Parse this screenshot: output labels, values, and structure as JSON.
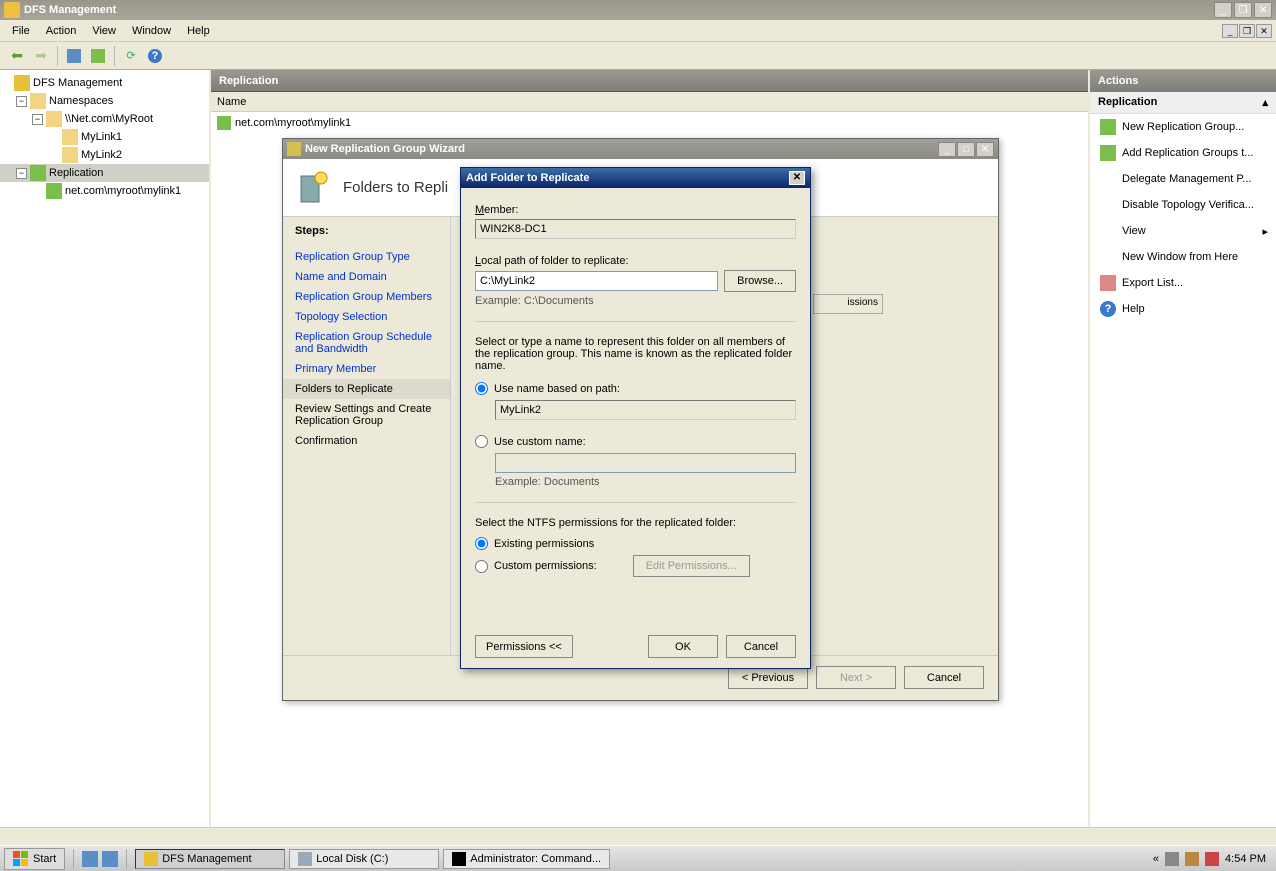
{
  "app": {
    "title": "DFS Management"
  },
  "menu": {
    "file": "File",
    "action": "Action",
    "view": "View",
    "window": "Window",
    "help": "Help"
  },
  "tree": {
    "root": "DFS Management",
    "namespaces": "Namespaces",
    "ns_root": "\\\\Net.com\\MyRoot",
    "link1": "MyLink1",
    "link2": "MyLink2",
    "replication": "Replication",
    "rep_item": "net.com\\myroot\\mylink1"
  },
  "center": {
    "group_header": "Replication",
    "col_name": "Name",
    "row1": "net.com\\myroot\\mylink1"
  },
  "actions": {
    "header": "Actions",
    "group": "Replication",
    "items": {
      "new_rep": "New Replication Group...",
      "add_rep": "Add Replication Groups t...",
      "delegate": "Delegate Management P...",
      "disable": "Disable Topology Verifica...",
      "view": "View",
      "newwin": "New Window from Here",
      "export": "Export List...",
      "help": "Help"
    }
  },
  "wizard": {
    "title": "New Replication Group Wizard",
    "heading": "Folders to Repli",
    "steps_header": "Steps:",
    "steps": {
      "s1": "Replication Group Type",
      "s2": "Name and Domain",
      "s3": "Replication Group Members",
      "s4": "Topology Selection",
      "s5": "Replication Group Schedule and Bandwidth",
      "s6": "Primary Member",
      "s7": "Folders to Replicate",
      "s8": "Review Settings and Create Replication Group",
      "s9": "Confirmation"
    },
    "hidden_tab": "issions",
    "buttons": {
      "prev": "< Previous",
      "next": "Next >",
      "cancel": "Cancel"
    }
  },
  "dialog": {
    "title": "Add Folder to Replicate",
    "member_label": "Member:",
    "member_value": "WIN2K8-DC1",
    "path_label": "Local path of folder to replicate:",
    "path_value": "C:\\MyLink2",
    "browse": "Browse...",
    "example_path": "Example: C:\\Documents",
    "name_instr": "Select or type a name to represent this folder on all members of the replication group. This name is known as the replicated folder name.",
    "radio_path": "Use name based on path:",
    "path_name_value": "MyLink2",
    "radio_custom": "Use custom name:",
    "example_name": "Example: Documents",
    "ntfs_label": "Select the NTFS permissions for the replicated folder:",
    "radio_existing": "Existing permissions",
    "radio_customperm": "Custom permissions:",
    "edit_perm": "Edit Permissions...",
    "btn_perm": "Permissions <<",
    "btn_ok": "OK",
    "btn_cancel": "Cancel"
  },
  "taskbar": {
    "start": "Start",
    "tasks": {
      "dfs": "DFS Management",
      "disk": "Local Disk (C:)",
      "cmd": "Administrator: Command..."
    },
    "time": "4:54 PM"
  }
}
